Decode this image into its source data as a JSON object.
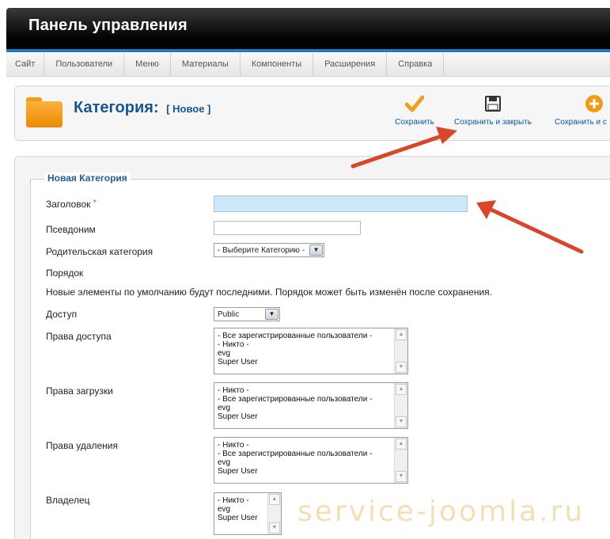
{
  "header": {
    "title": "Панель управления"
  },
  "menu": [
    "Сайт",
    "Пользователи",
    "Меню",
    "Материалы",
    "Компоненты",
    "Расширения",
    "Справка"
  ],
  "toolbar": {
    "title": "Категория:",
    "subtitle": "[ Новое ]",
    "icon": "folder-icon",
    "buttons": [
      {
        "label": "Сохранить",
        "icon": "check-icon"
      },
      {
        "label": "Сохранить и закрыть",
        "icon": "floppy-disk-icon"
      },
      {
        "label": "Сохранить и с",
        "icon": "plus-circle-icon"
      }
    ]
  },
  "form": {
    "legend": "Новая Категория",
    "title_label": "Заголовок",
    "required_mark": "*",
    "title_value": "",
    "alias_label": "Псевдоним",
    "alias_value": "",
    "parent_label": "Родительская категория",
    "parent_value": "- Выберите Категорию -",
    "ordering_label": "Порядок",
    "ordering_note": "Новые элементы по умолчанию будут последними. Порядок может быть изменён после сохранения.",
    "access_label": "Доступ",
    "access_value": "Public",
    "rights_access_label": "Права доступа",
    "rights_access_options": [
      "- Все зарегистрированные пользователи -",
      "- Никто -",
      "evg",
      "Super User"
    ],
    "rights_upload_label": "Права загрузки",
    "rights_upload_options": [
      "- Никто -",
      "- Все зарегистрированные пользователи -",
      "evg",
      "Super User"
    ],
    "rights_delete_label": "Права удаления",
    "rights_delete_options": [
      "- Никто -",
      "- Все зарегистрированные пользователи -",
      "evg",
      "Super User"
    ],
    "owner_label": "Владелец",
    "owner_options": [
      "- Никто -",
      "evg",
      "Super User"
    ]
  },
  "watermark": "service-joomla.ru",
  "colors": {
    "accent": "#1f7dbf",
    "title": "#14578e",
    "active_input": "#cfe8f9",
    "arrow": "#d9472b",
    "folder": "#f29a12"
  }
}
